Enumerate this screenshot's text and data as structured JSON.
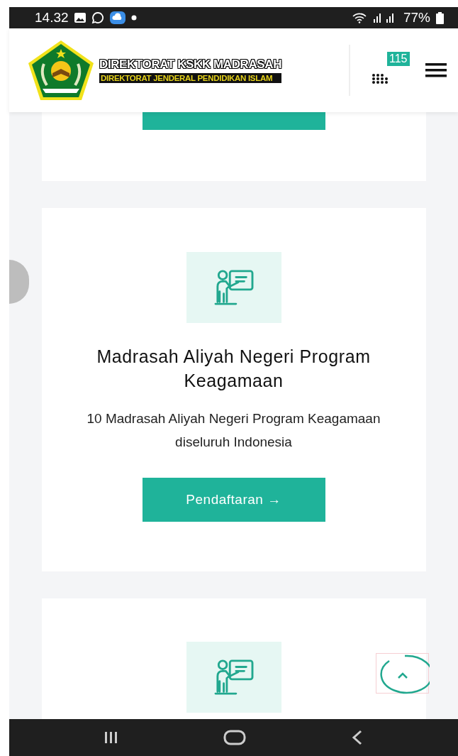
{
  "status_bar": {
    "time": "14.32",
    "battery": "77%"
  },
  "header": {
    "logo_title": "DIREKTORAT KSKK MADRASAH",
    "logo_subtitle": "DIREKTORAT JENDERAL PENDIDIKAN ISLAM",
    "badge": "115"
  },
  "cards": [
    {
      "kind": "cut_top"
    },
    {
      "kind": "full",
      "title": "Madrasah Aliyah Negeri Program Keagamaan",
      "description": "10 Madrasah Aliyah Negeri Program Keagamaan diseluruh Indonesia",
      "button": "Pendaftaran →"
    },
    {
      "kind": "cut_bottom"
    }
  ]
}
